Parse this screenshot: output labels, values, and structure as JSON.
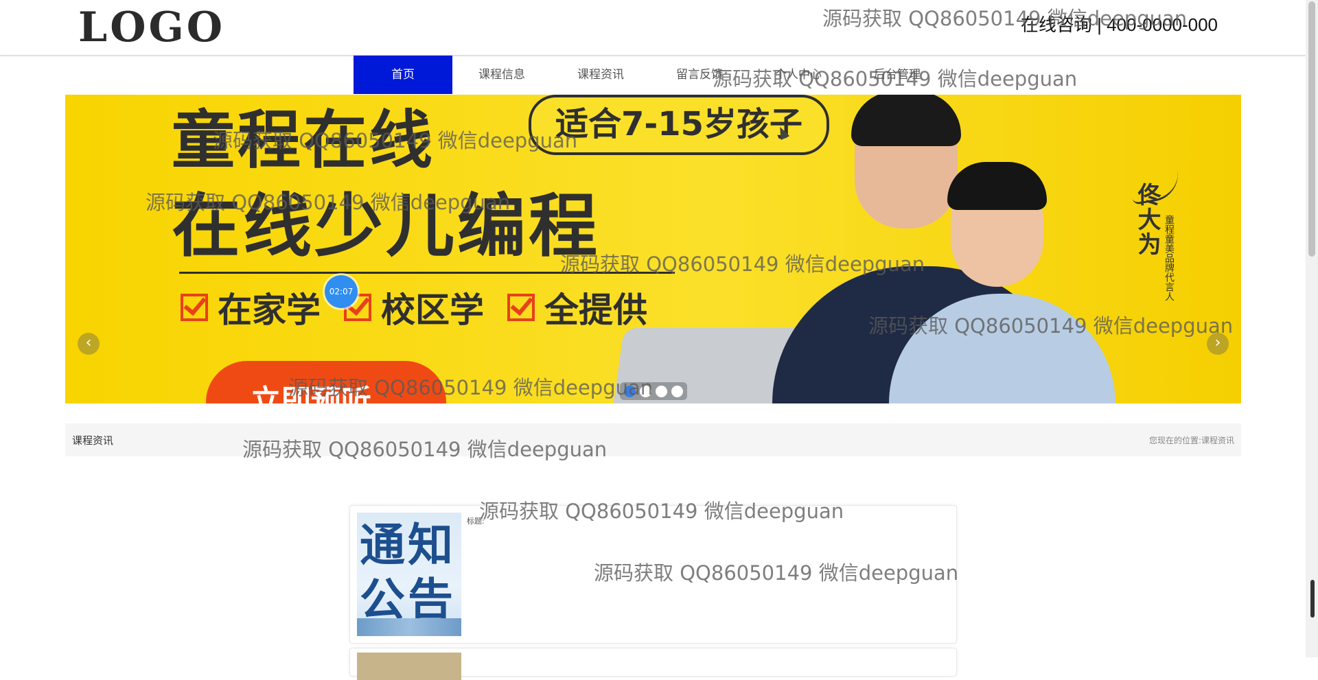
{
  "header": {
    "logo": "LOGO",
    "hotline": "在线咨询 | 400-0000-000"
  },
  "nav": {
    "items": [
      {
        "label": "首页",
        "active": true
      },
      {
        "label": "课程信息",
        "active": false
      },
      {
        "label": "课程资讯",
        "active": false
      },
      {
        "label": "留言反馈",
        "active": false
      },
      {
        "label": "个人中心",
        "active": false
      },
      {
        "label": "后台管理",
        "active": false
      }
    ]
  },
  "banner": {
    "title_line1": "童程在线",
    "title_line2": "在线少儿编程",
    "bubble": "适合7-15岁孩子",
    "features": [
      "在家学",
      "校区学",
      "全提供"
    ],
    "cta": "立即预听",
    "signature_name": "佟大为",
    "signature_sub": "童程童美品牌代言人",
    "timer": "02:07",
    "prev_icon": "‹",
    "next_icon": "›",
    "slide_count": 4,
    "active_slide": 1
  },
  "breadcrumb": {
    "title": "课程资讯",
    "location_prefix": "您现在的位置:",
    "location_current": "课程资讯"
  },
  "news_list": [
    {
      "thumbnail_text": "通知公告",
      "title_label": "标题:"
    },
    {
      "thumbnail_text": "",
      "title_label": ""
    }
  ],
  "watermark": {
    "text": "源码获取 QQ86050149 微信deepguan"
  },
  "colors": {
    "nav_active": "#0018d8",
    "banner_bg": "#f8d400",
    "cta": "#f04a14",
    "check": "#e8401a",
    "timer": "#2f8ef0"
  }
}
